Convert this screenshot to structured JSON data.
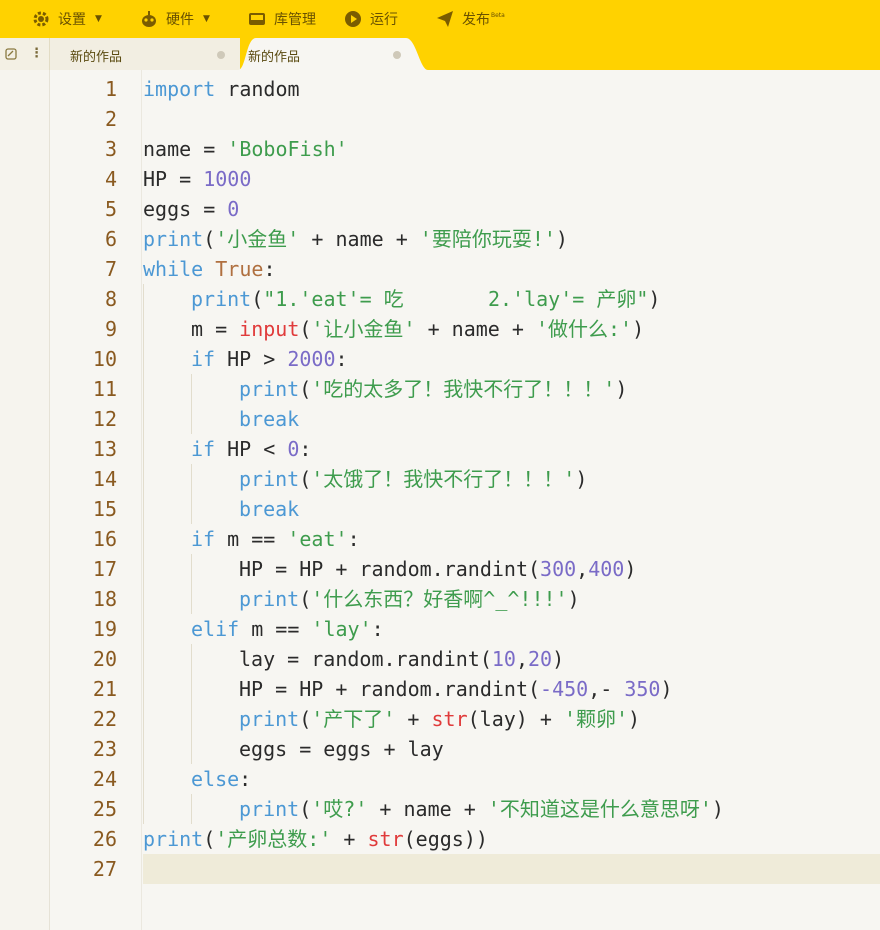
{
  "menu": {
    "settings": "设置",
    "hardware": "硬件",
    "library": "库管理",
    "run": "运行",
    "publish": "发布",
    "publish_badge": "Beta"
  },
  "tabs": [
    {
      "label": "新的作品",
      "active": false
    },
    {
      "label": "新的作品",
      "active": true
    }
  ],
  "editor": {
    "current_line": 27,
    "lines": [
      {
        "n": "1",
        "indent": 0,
        "tokens": [
          [
            "kw",
            "import"
          ],
          [
            "p",
            " random"
          ]
        ]
      },
      {
        "n": "2",
        "indent": 0,
        "tokens": []
      },
      {
        "n": "3",
        "indent": 0,
        "tokens": [
          [
            "p",
            "name = "
          ],
          [
            "str",
            "'BoboFish'"
          ]
        ]
      },
      {
        "n": "4",
        "indent": 0,
        "tokens": [
          [
            "p",
            "HP = "
          ],
          [
            "num",
            "1000"
          ]
        ]
      },
      {
        "n": "5",
        "indent": 0,
        "tokens": [
          [
            "p",
            "eggs = "
          ],
          [
            "num",
            "0"
          ]
        ]
      },
      {
        "n": "6",
        "indent": 0,
        "tokens": [
          [
            "kw",
            "print"
          ],
          [
            "p",
            "("
          ],
          [
            "str",
            "'小金鱼'"
          ],
          [
            "p",
            " + name + "
          ],
          [
            "str",
            "'要陪你玩耍!'"
          ],
          [
            "p",
            ")"
          ]
        ]
      },
      {
        "n": "7",
        "indent": 0,
        "tokens": [
          [
            "kw",
            "while"
          ],
          [
            "p",
            " "
          ],
          [
            "cst",
            "True"
          ],
          [
            "p",
            ":"
          ]
        ]
      },
      {
        "n": "8",
        "indent": 1,
        "tokens": [
          [
            "kw",
            "print"
          ],
          [
            "p",
            "("
          ],
          [
            "str",
            "\"1.'eat'= 吃       2.'lay'= 产卵\""
          ],
          [
            "p",
            ")"
          ]
        ]
      },
      {
        "n": "9",
        "indent": 1,
        "tokens": [
          [
            "p",
            "m = "
          ],
          [
            "bi",
            "input"
          ],
          [
            "p",
            "("
          ],
          [
            "str",
            "'让小金鱼'"
          ],
          [
            "p",
            " + name + "
          ],
          [
            "str",
            "'做什么:'"
          ],
          [
            "p",
            ")"
          ]
        ]
      },
      {
        "n": "10",
        "indent": 1,
        "tokens": [
          [
            "kw",
            "if"
          ],
          [
            "p",
            " HP > "
          ],
          [
            "num",
            "2000"
          ],
          [
            "p",
            ":"
          ]
        ]
      },
      {
        "n": "11",
        "indent": 2,
        "tokens": [
          [
            "kw",
            "print"
          ],
          [
            "p",
            "("
          ],
          [
            "str",
            "'吃的太多了！我快不行了！！！'"
          ],
          [
            "p",
            ")"
          ]
        ]
      },
      {
        "n": "12",
        "indent": 2,
        "tokens": [
          [
            "kw",
            "break"
          ]
        ]
      },
      {
        "n": "13",
        "indent": 1,
        "tokens": [
          [
            "kw",
            "if"
          ],
          [
            "p",
            " HP < "
          ],
          [
            "num",
            "0"
          ],
          [
            "p",
            ":"
          ]
        ]
      },
      {
        "n": "14",
        "indent": 2,
        "tokens": [
          [
            "kw",
            "print"
          ],
          [
            "p",
            "("
          ],
          [
            "str",
            "'太饿了！我快不行了！！！'"
          ],
          [
            "p",
            ")"
          ]
        ]
      },
      {
        "n": "15",
        "indent": 2,
        "tokens": [
          [
            "kw",
            "break"
          ]
        ]
      },
      {
        "n": "16",
        "indent": 1,
        "tokens": [
          [
            "kw",
            "if"
          ],
          [
            "p",
            " m == "
          ],
          [
            "str",
            "'eat'"
          ],
          [
            "p",
            ":"
          ]
        ]
      },
      {
        "n": "17",
        "indent": 2,
        "tokens": [
          [
            "p",
            "HP = HP + random.randint("
          ],
          [
            "num",
            "300"
          ],
          [
            "p",
            ","
          ],
          [
            "num",
            "400"
          ],
          [
            "p",
            ")"
          ]
        ]
      },
      {
        "n": "18",
        "indent": 2,
        "tokens": [
          [
            "kw",
            "print"
          ],
          [
            "p",
            "("
          ],
          [
            "str",
            "'什么东西？好香啊^_^!!!'"
          ],
          [
            "p",
            ")"
          ]
        ]
      },
      {
        "n": "19",
        "indent": 1,
        "tokens": [
          [
            "kw",
            "elif"
          ],
          [
            "p",
            " m == "
          ],
          [
            "str",
            "'lay'"
          ],
          [
            "p",
            ":"
          ]
        ]
      },
      {
        "n": "20",
        "indent": 2,
        "tokens": [
          [
            "p",
            "lay = random.randint("
          ],
          [
            "num",
            "10"
          ],
          [
            "p",
            ","
          ],
          [
            "num",
            "20"
          ],
          [
            "p",
            ")"
          ]
        ]
      },
      {
        "n": "21",
        "indent": 2,
        "tokens": [
          [
            "p",
            "HP = HP + random.randint("
          ],
          [
            "num",
            "-450"
          ],
          [
            "p",
            ",- "
          ],
          [
            "num",
            "350"
          ],
          [
            "p",
            ")"
          ]
        ]
      },
      {
        "n": "22",
        "indent": 2,
        "tokens": [
          [
            "kw",
            "print"
          ],
          [
            "p",
            "("
          ],
          [
            "str",
            "'产下了'"
          ],
          [
            "p",
            " + "
          ],
          [
            "bi",
            "str"
          ],
          [
            "p",
            "(lay) + "
          ],
          [
            "str",
            "'颗卵'"
          ],
          [
            "p",
            ")"
          ]
        ]
      },
      {
        "n": "23",
        "indent": 2,
        "tokens": [
          [
            "p",
            "eggs = eggs + lay"
          ]
        ]
      },
      {
        "n": "24",
        "indent": 1,
        "tokens": [
          [
            "kw",
            "else"
          ],
          [
            "p",
            ":"
          ]
        ]
      },
      {
        "n": "25",
        "indent": 2,
        "tokens": [
          [
            "kw",
            "print"
          ],
          [
            "p",
            "("
          ],
          [
            "str",
            "'哎?'"
          ],
          [
            "p",
            " + name + "
          ],
          [
            "str",
            "'不知道这是什么意思呀'"
          ],
          [
            "p",
            ")"
          ]
        ]
      },
      {
        "n": "26",
        "indent": 0,
        "tokens": [
          [
            "kw",
            "print"
          ],
          [
            "p",
            "("
          ],
          [
            "str",
            "'产卵总数:'"
          ],
          [
            "p",
            " + "
          ],
          [
            "bi",
            "str"
          ],
          [
            "p",
            "(eggs))"
          ]
        ]
      },
      {
        "n": "27",
        "indent": 0,
        "tokens": []
      }
    ]
  }
}
